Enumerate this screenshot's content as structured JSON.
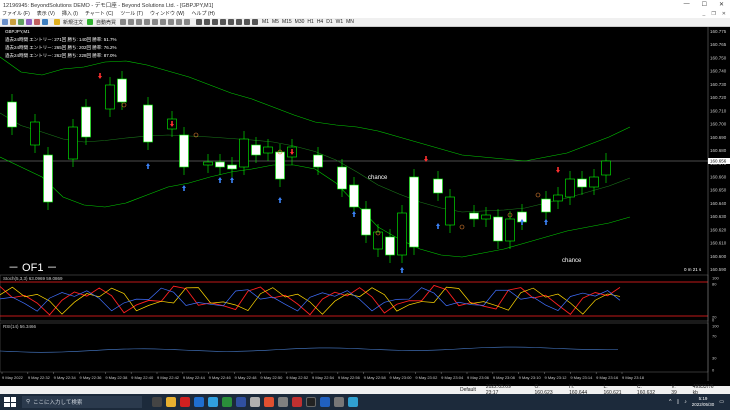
{
  "window": {
    "title": "12196945: BeyondSolutions DEMO - デモ口座 - Beyond Solutions Ltd. - [GBPJPY,M1]"
  },
  "menu": {
    "items": [
      "ファイル (F)",
      "表示 (V)",
      "挿入 (I)",
      "チャート (C)",
      "ツール (T)",
      "ウィンドウ (W)",
      "ヘルプ (H)"
    ]
  },
  "toolbar": {
    "new_order": "新規注文",
    "auto_trade": "自動売買",
    "timeframes": [
      "M1",
      "M5",
      "M15",
      "M30",
      "H1",
      "H4",
      "D1",
      "W1",
      "MN"
    ]
  },
  "chart": {
    "symbol_label": "GBPJPY,M1",
    "stats": [
      "過去24時間  エントリー: 271回  勝ち: 140回  勝率: 51.7%",
      "過去24時間  エントリー: 265回  勝ち: 202回  勝率: 76.2%",
      "過去24時間  エントリー: 262回  勝ち: 228回  勝率: 87.0%"
    ],
    "price_labels": [
      "160.775",
      "160.765",
      "160.750",
      "160.740",
      "160.730",
      "160.720",
      "160.710",
      "160.700",
      "160.690",
      "160.680",
      "160.670",
      "160.660",
      "160.650",
      "160.640",
      "160.630",
      "160.620",
      "160.610",
      "160.600",
      "160.590"
    ],
    "current_price": "160.656",
    "chance_labels": [
      "chance",
      "chance"
    ],
    "of1_label": "－ OF1 －",
    "timer": "0 m 21 s",
    "stoch_label": "Stoch(5,3,3) 63.0969 59.0869",
    "stoch_levels": [
      "100",
      "80",
      "20",
      "0"
    ],
    "rsi_label": "RSI(14) 56.3466",
    "rsi_levels": [
      "100",
      "70",
      "30",
      "0"
    ],
    "time_labels": [
      "9 May 2022",
      "9 May 22:32",
      "9 May 22:34",
      "9 May 22:36",
      "9 May 22:38",
      "9 May 22:40",
      "9 May 22:42",
      "9 May 22:44",
      "9 May 22:46",
      "9 May 22:48",
      "9 May 22:50",
      "9 May 22:52",
      "9 May 22:54",
      "9 May 22:56",
      "9 May 22:58",
      "9 May 23:00",
      "9 May 23:02",
      "9 May 23:04",
      "9 May 23:06",
      "9 May 23:08",
      "9 May 23:10",
      "9 May 23:12",
      "9 May 23:14",
      "9 May 23:16",
      "9 May 23:18"
    ],
    "colors": {
      "bull": "#00ff00",
      "bear": "#00ff00",
      "band": "#00cc00",
      "stoch_k": "#ffd700",
      "stoch_d": "#ff2020",
      "stoch_blue": "#4070ff",
      "rsi": "#4a7fd0",
      "arrow_up": "#3b82f6",
      "arrow_down": "#ff3030"
    }
  },
  "status": {
    "default": "Default",
    "time": "2022.05.09 23:17",
    "o": "O: 160.623",
    "h": "H: 160.644",
    "l": "L: 160.621",
    "c": "C: 160.632",
    "v": "V: 39",
    "net": "499337/6 kb"
  },
  "taskbar": {
    "search": "ここに入力して検索",
    "time": "5:19",
    "date": "2022/05/30"
  }
}
